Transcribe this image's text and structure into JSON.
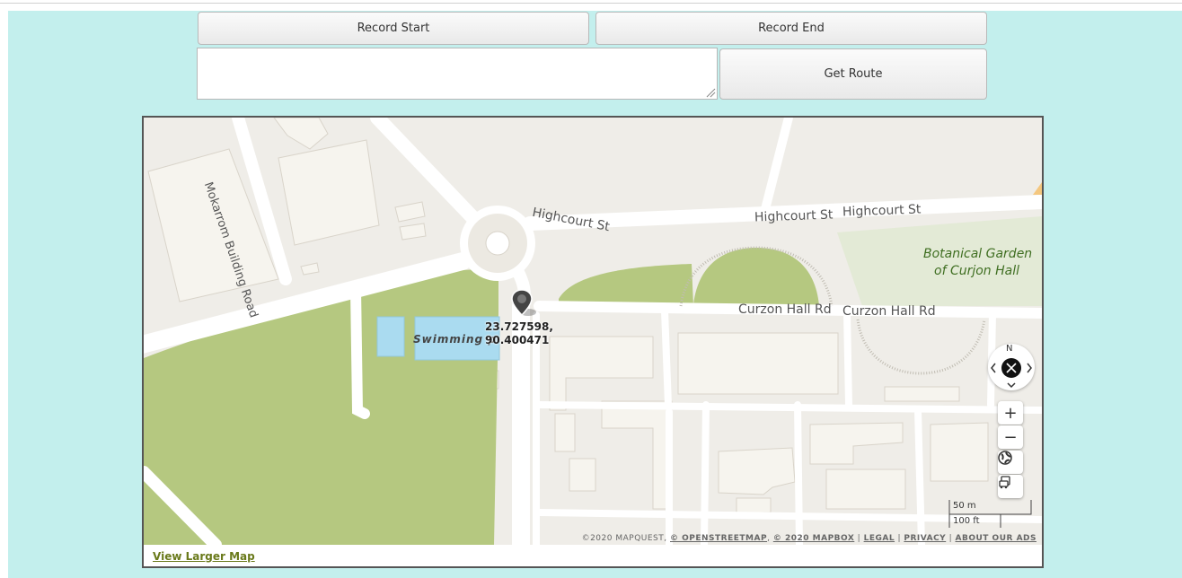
{
  "controls": {
    "record_start": "Record Start",
    "record_end": "Record End",
    "get_route": "Get Route",
    "route_text": ""
  },
  "map": {
    "labels": {
      "road_mokarrom": "Mokarrom Building Road",
      "road_highcourt_1": "Highcourt St",
      "road_highcourt_2": "Highcourt St",
      "road_highcourt_3": "Highcourt St",
      "road_curzon_1": "Curzon Hall Rd",
      "road_curzon_2": "Curzon Hall Rd",
      "garden_line1": "Botanical Garden",
      "garden_line2": "of Curjon Hall",
      "swimming": "Swimming p"
    },
    "marker": {
      "lat": "23.727598,",
      "lon": "90.400471"
    },
    "compass_label": "N",
    "zoom_in": "+",
    "zoom_out": "−",
    "scale_metric": "50 m",
    "scale_imperial": "100 ft",
    "attribution": {
      "copyright": "©2020 MAPQUEST,",
      "osm": "© OPENSTREETMAP",
      "mapbox": "© 2020 MAPBOX",
      "legal": "LEGAL",
      "privacy": "PRIVACY",
      "ads": "ABOUT OUR ADS",
      "sep": "|"
    },
    "view_larger": "View Larger Map"
  },
  "colors": {
    "panel_bg": "#c3efed",
    "map_land": "#efede8",
    "park_green": "#b5c880",
    "water_blue": "#aadbf0",
    "road_white": "#ffffff",
    "link_green": "#6a7a1b"
  },
  "icons": [
    "compass-icon",
    "globe-icon",
    "traffic-icon",
    "map-marker-icon",
    "resize-grip-icon"
  ]
}
